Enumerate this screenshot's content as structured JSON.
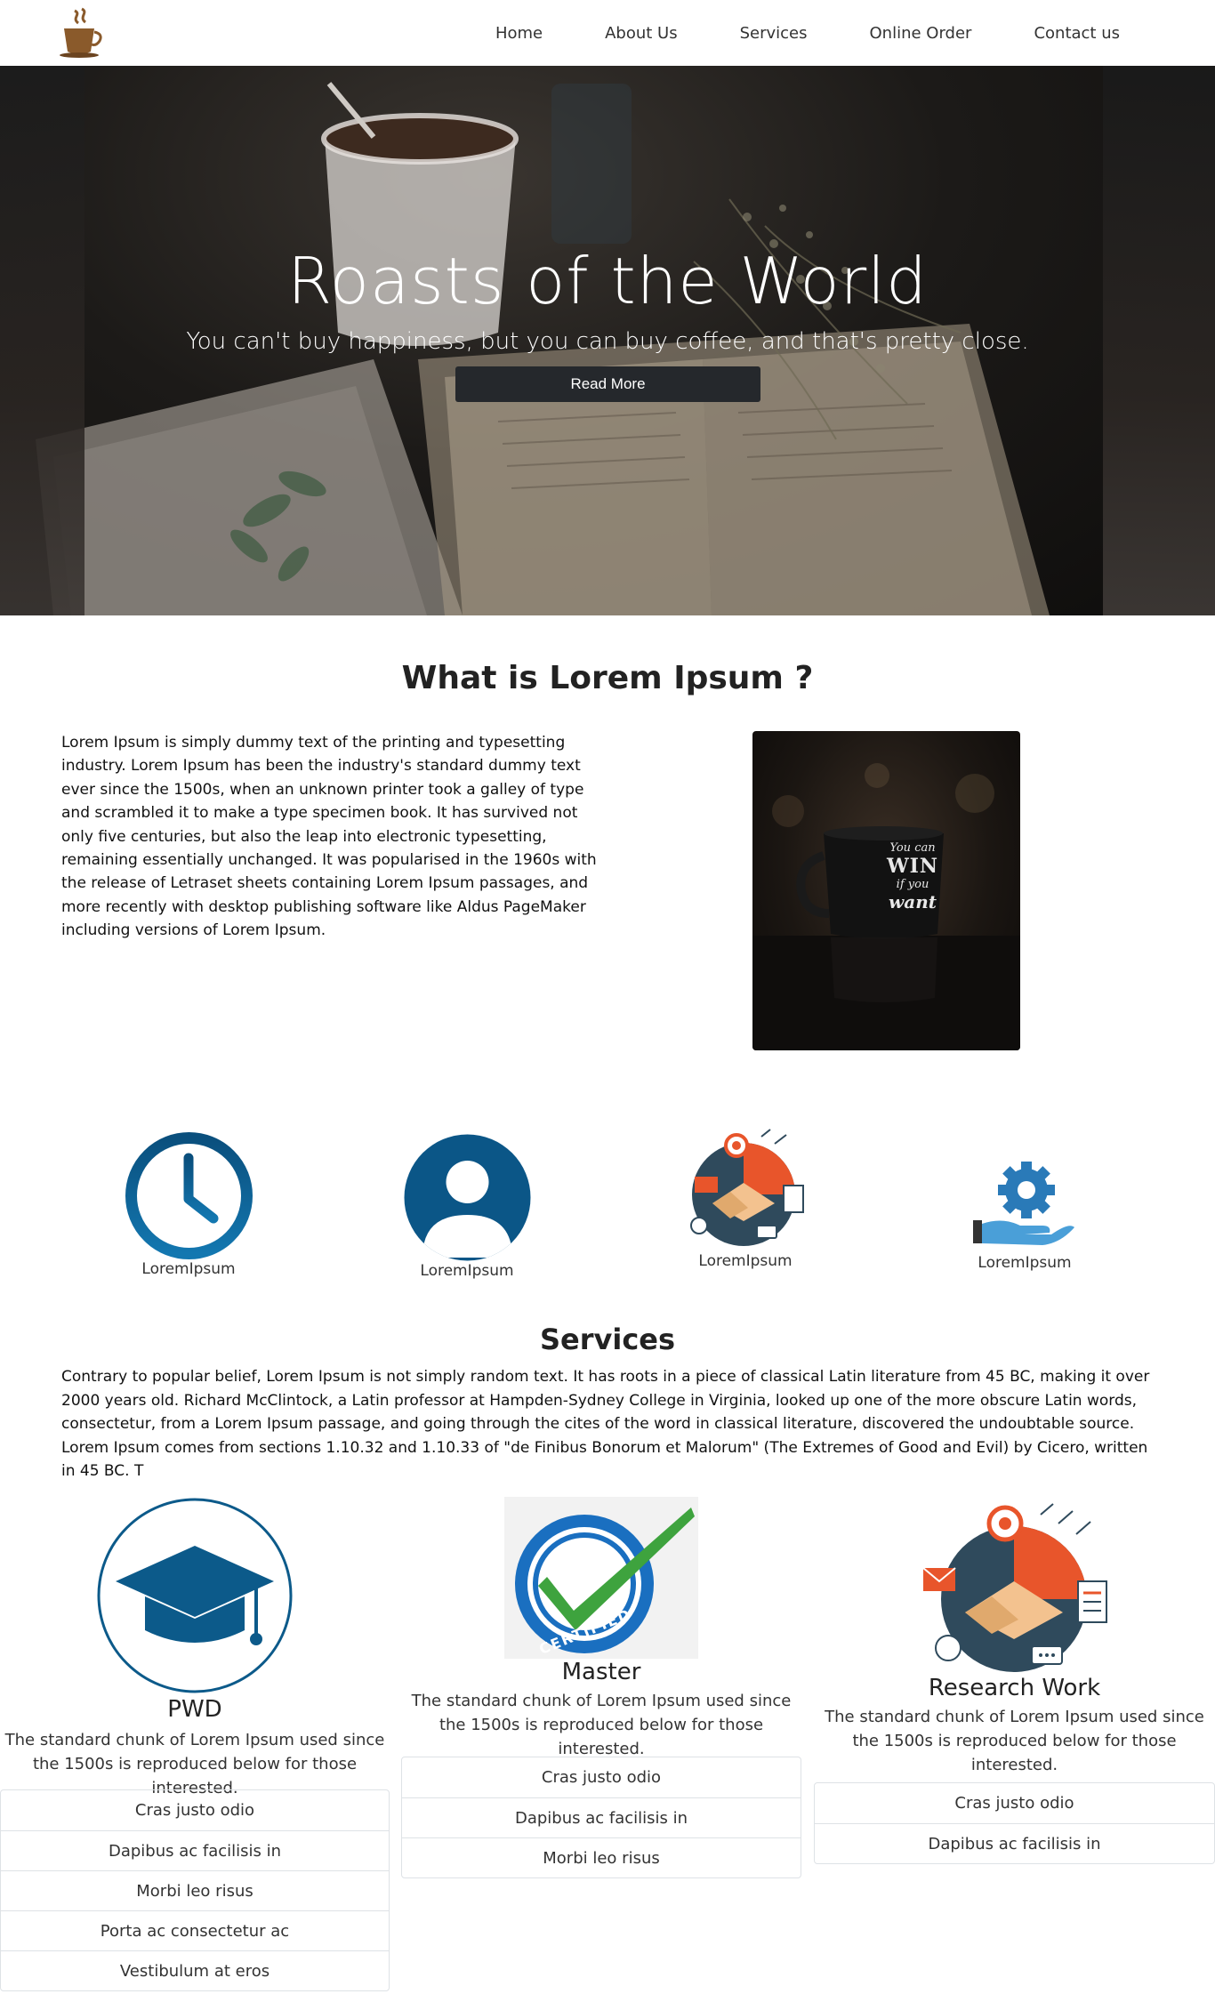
{
  "nav": {
    "items": [
      {
        "label": "Home"
      },
      {
        "label": "About Us"
      },
      {
        "label": "Services"
      },
      {
        "label": "Online Order"
      },
      {
        "label": "Contact us"
      }
    ]
  },
  "hero": {
    "title": "Roasts of the World",
    "subtitle": "You can't buy happiness, but you can buy coffee, and that's pretty close.",
    "button_label": "Read More"
  },
  "about": {
    "title": "What is Lorem Ipsum ?",
    "text": "Lorem Ipsum is simply dummy text of the printing and typesetting industry. Lorem Ipsum has been the industry's standard dummy text ever since the 1500s, when an unknown printer took a galley of type and scrambled it to make a type specimen book. It has survived not only five centuries, but also the leap into electronic typesetting, remaining essentially unchanged. It was popularised in the 1960s with the release of Letraset sheets containing Lorem Ipsum passages, and more recently with desktop publishing software like Aldus PageMaker including versions of Lorem Ipsum.",
    "mug_text": [
      "You can",
      "WIN",
      "if you",
      "want"
    ]
  },
  "features": [
    {
      "label": "LoremIpsum",
      "icon": "clock-icon"
    },
    {
      "label": "LoremIpsum",
      "icon": "user-icon"
    },
    {
      "label": "LoremIpsum",
      "icon": "handshake-icon"
    },
    {
      "label": "LoremIpsum",
      "icon": "gear-hand-icon"
    }
  ],
  "services": {
    "title": "Services",
    "text": "Contrary to popular belief, Lorem Ipsum is not simply random text. It has roots in a piece of classical Latin literature from 45 BC, making it over 2000 years old. Richard McClintock, a Latin professor at Hampden-Sydney College in Virginia, looked up one of the more obscure Latin words, consectetur, from a Lorem Ipsum passage, and going through the cites of the word in classical literature, discovered the undoubtable source. Lorem Ipsum comes from sections 1.10.32 and 1.10.33 of \"de Finibus Bonorum et Malorum\" (The Extremes of Good and Evil) by Cicero, written in 45 BC. T",
    "cards": [
      {
        "title": "PWD",
        "text": "The standard chunk of Lorem Ipsum used since the 1500s is reproduced below for those interested.",
        "items": [
          "Cras justo odio",
          "Dapibus ac facilisis in",
          "Morbi leo risus",
          "Porta ac consectetur ac",
          "Vestibulum at eros"
        ]
      },
      {
        "title": "Master",
        "badge_text": "CERTIFIED",
        "text": "The standard chunk of Lorem Ipsum used since the 1500s is reproduced below for those interested.",
        "items": [
          "Cras justo odio",
          "Dapibus ac facilisis in",
          "Morbi leo risus"
        ]
      },
      {
        "title": "Research Work",
        "text": "The standard chunk of Lorem Ipsum used since the 1500s is reproduced below for those interested.",
        "items": [
          "Cras justo odio",
          "Dapibus ac facilisis in"
        ]
      }
    ]
  },
  "colors": {
    "icon_blue": "#0c5a8a",
    "hero_button": "#25282c",
    "check_green": "#3ea33e",
    "handshake_orange": "#e8552b"
  }
}
